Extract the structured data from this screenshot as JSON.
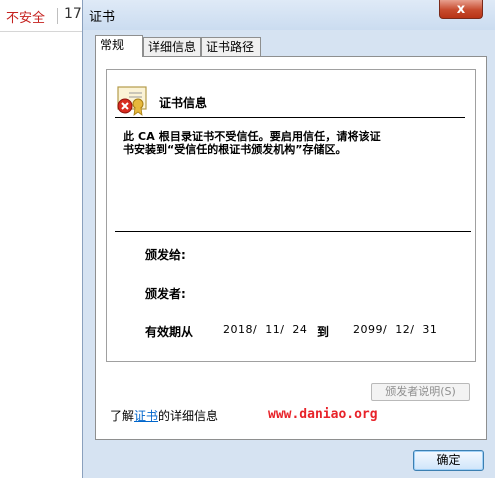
{
  "browser": {
    "security_label": "不安全",
    "address_fragment": "17"
  },
  "dialog": {
    "title": "证书",
    "close_symbol": "x",
    "tabs": [
      {
        "label": "常规"
      },
      {
        "label": "详细信息"
      },
      {
        "label": "证书路径"
      }
    ],
    "cert_info": {
      "heading": "证书信息",
      "warning_line1": "此 CA 根目录证书不受信任。要启用信任，请将该证",
      "warning_line2": "书安装到“受信任的根证书颁发机构”存储区。",
      "issued_to_label": "颁发给:",
      "issued_by_label": "颁发者:",
      "valid_label": "有效期从",
      "valid_from": "2018/  11/  24",
      "valid_to_word": "到",
      "valid_to": "2099/  12/  31"
    },
    "issuer_statement_button": "颁发者说明(S)",
    "learn_more_prefix": "了解",
    "learn_more_link": "证书",
    "learn_more_suffix": "的详细信息",
    "watermark": "www.daniao.org",
    "ok_button": "确定"
  }
}
